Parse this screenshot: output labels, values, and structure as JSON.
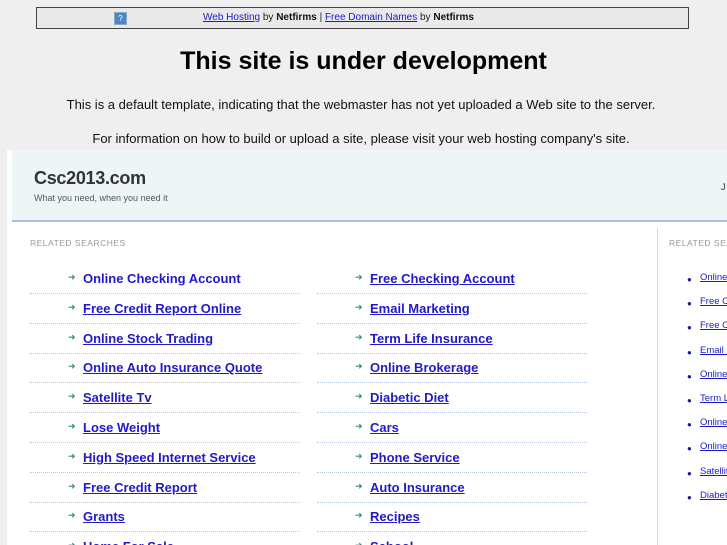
{
  "topbar": {
    "icon": "help-icon",
    "link1": "Web Hosting",
    "by1": "by",
    "brand1": "Netfirms",
    "sep": "|",
    "link2": "Free Domain Names",
    "by2": "by",
    "brand2": "Netfirms"
  },
  "heading": "This site is under development",
  "para1": "This is a default template, indicating that the webmaster has not yet uploaded a Web site to the server.",
  "para2": "For information on how to build or upload a site, please visit your web hosting company's site.",
  "site": {
    "name": "Csc2013.com",
    "tagline": "What you need, when you need it",
    "right_char": "J"
  },
  "related_label": "RELATED SEARCHES",
  "right_label": "RELATED SEARCHES",
  "left_col": [
    "Online Checking Account",
    "Free Credit Report Online",
    "Online Stock Trading",
    "Online Auto Insurance Quote",
    "Satellite Tv",
    "Lose Weight",
    "High Speed Internet Service",
    "Free Credit Report",
    "Grants",
    "Home For Sale"
  ],
  "mid_col": [
    "Free Checking Account",
    "Email Marketing",
    "Term Life Insurance",
    "Online Brokerage",
    "Diabetic Diet",
    "Cars",
    "Phone Service",
    "Auto Insurance",
    "Recipes",
    "School"
  ],
  "right_col": [
    "Online Checking Account",
    "Free Checking Account",
    "Free Credit Report Online",
    "Email Marketing",
    "Online Stock Trading",
    "Term Life Insurance",
    "Online Auto Insurance Quote",
    "Online Brokerage",
    "Satellite Tv",
    "Diabetic Diet"
  ]
}
